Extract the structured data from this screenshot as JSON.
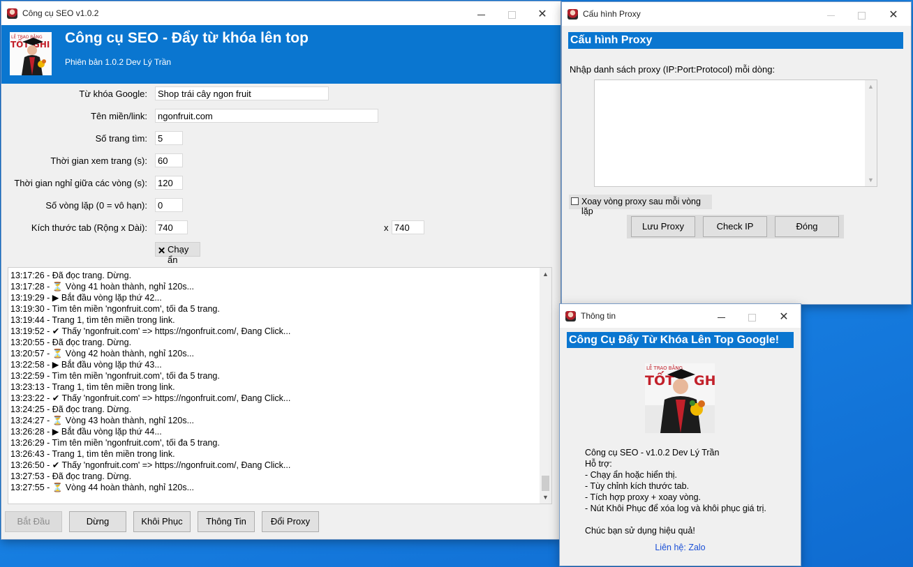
{
  "main_window": {
    "title": "Công cụ SEO v1.0.2",
    "header_title": "Công cụ SEO - Đẩy từ khóa lên top",
    "header_subtitle": "Phiên bản 1.0.2 Dev Lý Trần",
    "fields": {
      "keyword": {
        "label": "Từ khóa Google:",
        "value": "Shop trái cây ngon fruit"
      },
      "domain": {
        "label": "Tên miền/link:",
        "value": "ngonfruit.com"
      },
      "pages": {
        "label": "Số trang tìm:",
        "value": "5"
      },
      "view_time": {
        "label": "Thời gian xem trang (s):",
        "value": "60"
      },
      "rest_time": {
        "label": "Thời gian nghỉ giữa các vòng (s):",
        "value": "120"
      },
      "loops": {
        "label": "Số vòng lặp (0 = vô hạn):",
        "value": "0"
      },
      "tab_size": {
        "label": "Kích thước tab (Rộng x Dài):",
        "width": "740",
        "x": "x",
        "height": "740"
      }
    },
    "hide_checkbox": {
      "label": "Chạy ẩn",
      "checked": true,
      "mark": "🗙"
    },
    "log_lines": [
      "13:17:26 - Đã đọc trang. Dừng.",
      "13:17:28 - ⏳ Vòng 41 hoàn thành, nghỉ 120s...",
      "13:19:29 - ▶ Bắt đầu vòng lặp thứ 42...",
      "13:19:30 - Tìm tên miền 'ngonfruit.com', tối đa 5 trang.",
      "13:19:44 - Trang 1, tìm tên miền trong link.",
      "13:19:52 - ✔ Thấy 'ngonfruit.com' => https://ngonfruit.com/, Đang Click...",
      "13:20:55 - Đã đọc trang. Dừng.",
      "13:20:57 - ⏳ Vòng 42 hoàn thành, nghỉ 120s...",
      "13:22:58 - ▶ Bắt đầu vòng lặp thứ 43...",
      "13:22:59 - Tìm tên miền 'ngonfruit.com', tối đa 5 trang.",
      "13:23:13 - Trang 1, tìm tên miền trong link.",
      "13:23:22 - ✔ Thấy 'ngonfruit.com' => https://ngonfruit.com/, Đang Click...",
      "13:24:25 - Đã đọc trang. Dừng.",
      "13:24:27 - ⏳ Vòng 43 hoàn thành, nghỉ 120s...",
      "13:26:28 - ▶ Bắt đầu vòng lặp thứ 44...",
      "13:26:29 - Tìm tên miền 'ngonfruit.com', tối đa 5 trang.",
      "13:26:43 - Trang 1, tìm tên miền trong link.",
      "13:26:50 - ✔ Thấy 'ngonfruit.com' => https://ngonfruit.com/, Đang Click...",
      "13:27:53 - Đã đọc trang. Dừng.",
      "13:27:55 - ⏳ Vòng 44 hoàn thành, nghỉ 120s..."
    ],
    "buttons": {
      "start": "Bắt Đầu",
      "stop": "Dừng",
      "restore": "Khôi Phục",
      "info": "Thông Tin",
      "proxy": "Đổi Proxy"
    }
  },
  "proxy_window": {
    "title": "Cấu hình Proxy",
    "header": "Cấu hình Proxy",
    "instruction": "Nhập danh sách proxy (IP:Port:Protocol) mỗi dòng:",
    "textarea_value": "",
    "rotate_checkbox": {
      "label": "Xoay vòng proxy sau mỗi vòng lặp",
      "checked": false
    },
    "buttons": {
      "save": "Lưu Proxy",
      "check": "Check IP",
      "close": "Đóng"
    }
  },
  "info_window": {
    "title": "Thông tin",
    "header": "Công Cụ Đẩy Từ Khóa Lên Top Google!",
    "lines": [
      "Công cụ SEO - v1.0.2 Dev Lý Trần",
      "Hỗ trợ:",
      "- Chạy ẩn hoặc hiển thị.",
      "- Tùy chỉnh kích thước tab.",
      "- Tích hợp proxy + xoay vòng.",
      "- Nút Khôi Phục để xóa log và khôi phục giá trị."
    ],
    "closing": "Chúc bạn sử dụng hiệu quả!",
    "contact": "Liên hệ: Zalo"
  },
  "colors": {
    "accent": "#0a76d0",
    "link": "#1a4fd6",
    "desktop": "#1a86e8"
  },
  "icons": {
    "minimize": "minimize-icon",
    "maximize": "maximize-icon",
    "close": "close-icon",
    "app": "app-icon"
  }
}
